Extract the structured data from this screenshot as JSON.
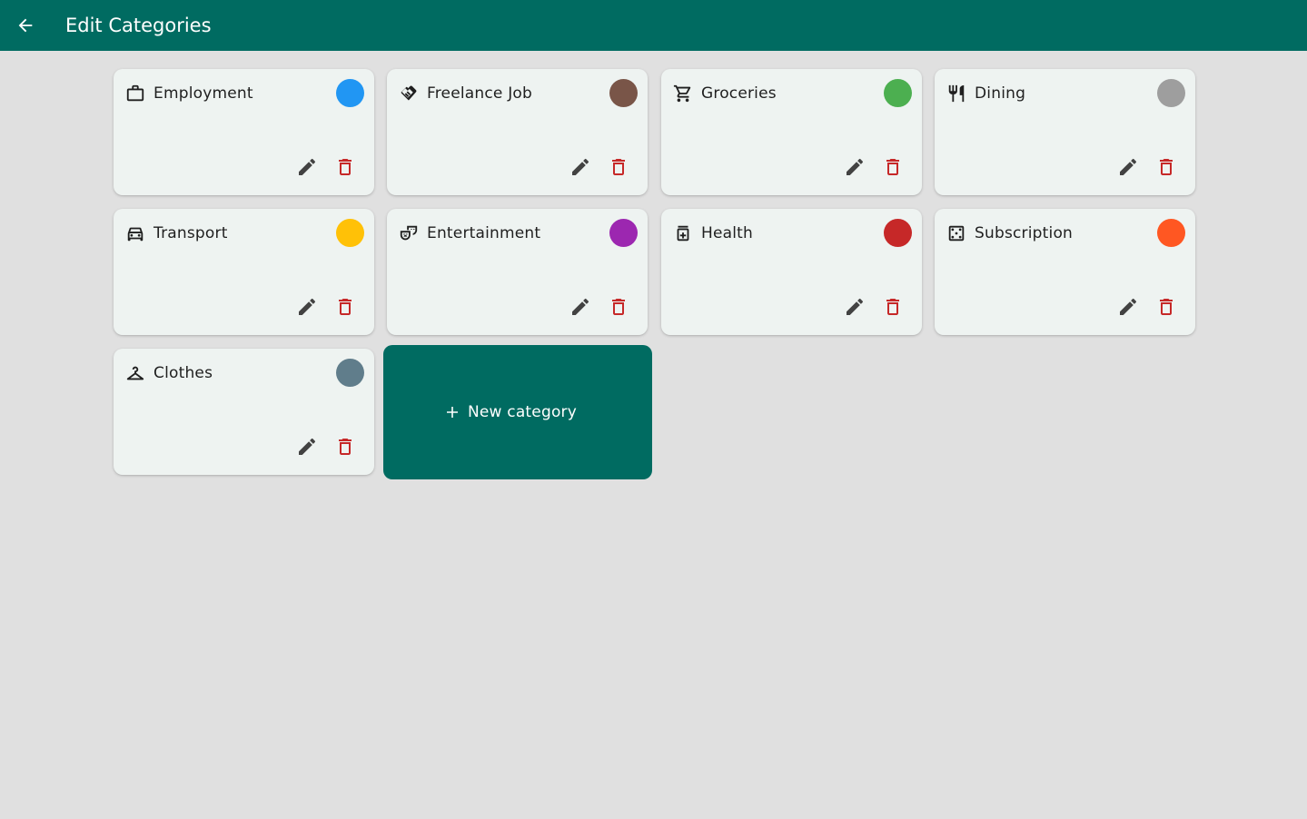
{
  "appbar": {
    "title": "Edit Categories",
    "back_icon": "arrow-back-icon"
  },
  "categories": [
    {
      "label": "Employment",
      "icon": "briefcase-icon",
      "color": "#2196f3"
    },
    {
      "label": "Freelance Job",
      "icon": "handshake-icon",
      "color": "#795548"
    },
    {
      "label": "Groceries",
      "icon": "shopping-cart-icon",
      "color": "#4caf50"
    },
    {
      "label": "Dining",
      "icon": "restaurant-icon",
      "color": "#9e9e9e"
    },
    {
      "label": "Transport",
      "icon": "car-icon",
      "color": "#ffc107"
    },
    {
      "label": "Entertainment",
      "icon": "theater-masks-icon",
      "color": "#9c27b0"
    },
    {
      "label": "Health",
      "icon": "medication-icon",
      "color": "#c62828"
    },
    {
      "label": "Subscription",
      "icon": "dice-icon",
      "color": "#ff5722"
    },
    {
      "label": "Clothes",
      "icon": "hanger-icon",
      "color": "#607d8b"
    }
  ],
  "actions": {
    "edit_icon": "pencil-icon",
    "delete_icon": "trash-icon",
    "edit_color": "#424242",
    "delete_color": "#c62828"
  },
  "new_category": {
    "label": "New category",
    "icon": "plus-icon"
  },
  "colors": {
    "primary": "#006b61",
    "background": "#e0e0e0",
    "card": "#eef3f1"
  }
}
